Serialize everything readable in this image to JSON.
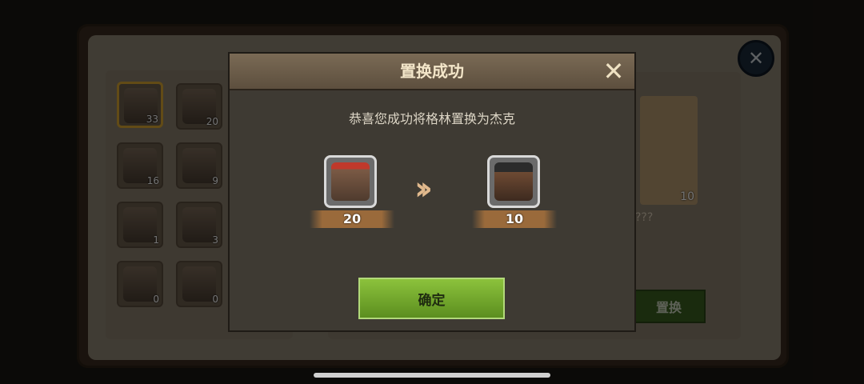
{
  "background": {
    "title": "",
    "left_counts": [
      "33",
      "20",
      "16",
      "9",
      "1",
      "3",
      "0",
      "0"
    ],
    "card_count": "10",
    "card_name": "???",
    "action_label": "置换",
    "close_icon": "close-icon"
  },
  "modal": {
    "title": "置换成功",
    "message": "恭喜您成功将格林置换为杰克",
    "from_count": "20",
    "to_count": "10",
    "confirm_label": "确定"
  }
}
